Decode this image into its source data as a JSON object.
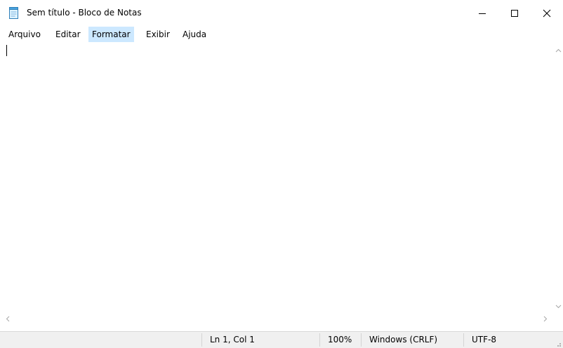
{
  "window": {
    "title": "Sem título - Bloco de Notas",
    "icon": "notepad-icon",
    "controls": [
      "minimize-icon",
      "maximize-icon",
      "close-icon"
    ]
  },
  "menu": {
    "items": [
      "Arquivo",
      "Editar",
      "Formatar",
      "Exibir",
      "Ajuda"
    ],
    "active": "Formatar"
  },
  "editor": {
    "text": ""
  },
  "status": {
    "position": "Ln 1, Col 1",
    "zoom": "100%",
    "line_ending": "Windows (CRLF)",
    "encoding": "UTF-8"
  },
  "colors": {
    "menu_highlight": "#cce8ff",
    "statusbar_bg": "#f0f0f0"
  }
}
